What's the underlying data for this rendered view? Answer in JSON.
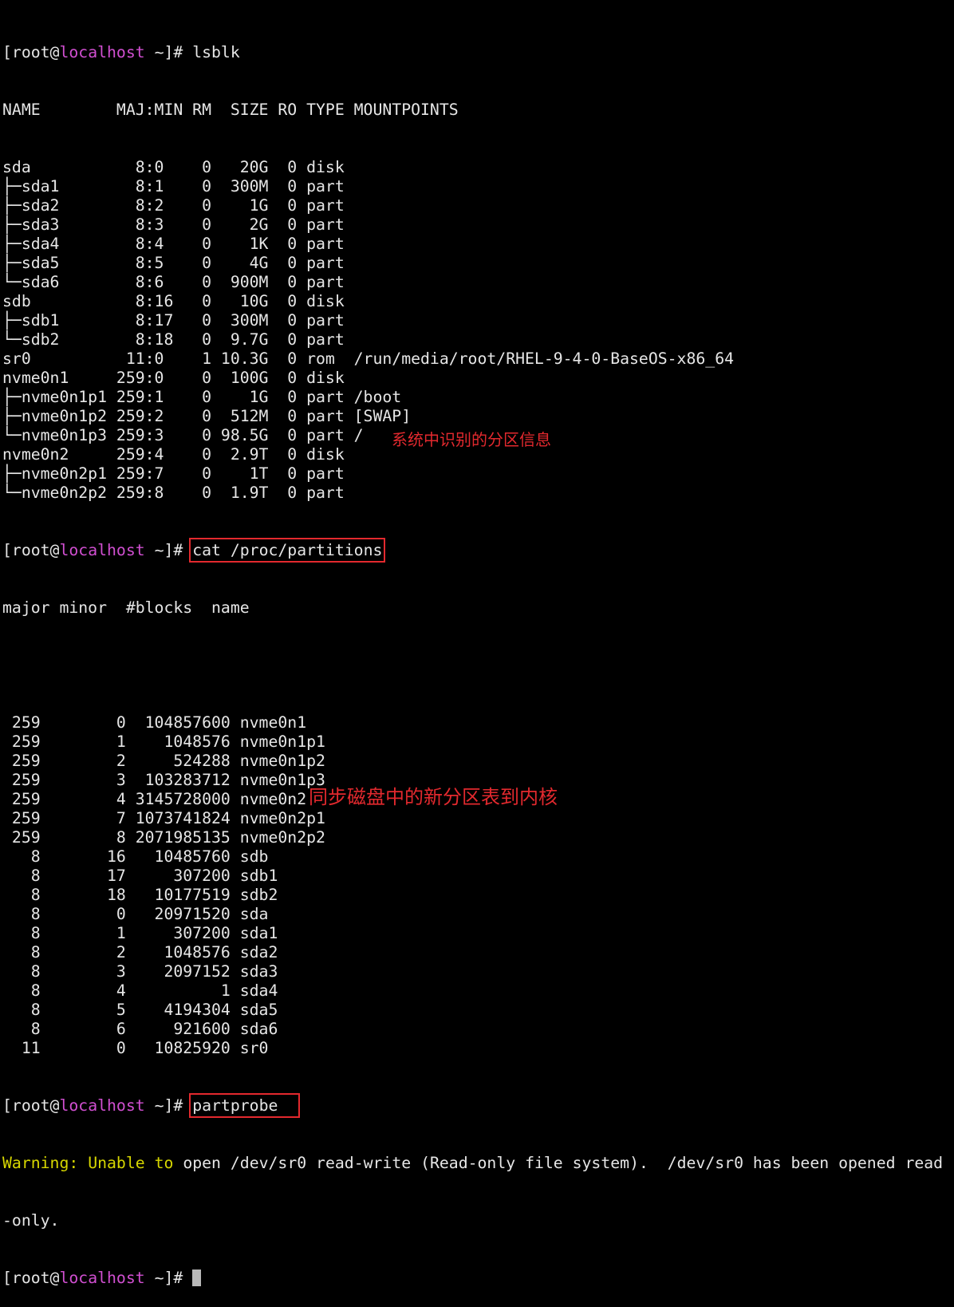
{
  "prompt": {
    "open": "[root@",
    "host": "localhost",
    "close": " ~]# "
  },
  "colors": {
    "background": "#000000",
    "text": "#e6e6e6",
    "hostname": "#d14fd1",
    "warning": "#d7d700",
    "annotation": "#e3292e"
  },
  "commands": {
    "lsblk": "lsblk",
    "cat": "cat /proc/partitions",
    "partprobe": "partprobe",
    "final": ""
  },
  "lsblk": {
    "header": "NAME        MAJ:MIN RM  SIZE RO TYPE MOUNTPOINTS",
    "rows": [
      "sda           8:0    0   20G  0 disk",
      "├─sda1        8:1    0  300M  0 part",
      "├─sda2        8:2    0    1G  0 part",
      "├─sda3        8:3    0    2G  0 part",
      "├─sda4        8:4    0    1K  0 part",
      "├─sda5        8:5    0    4G  0 part",
      "└─sda6        8:6    0  900M  0 part",
      "sdb           8:16   0   10G  0 disk",
      "├─sdb1        8:17   0  300M  0 part",
      "└─sdb2        8:18   0  9.7G  0 part",
      "sr0          11:0    1 10.3G  0 rom  /run/media/root/RHEL-9-4-0-BaseOS-x86_64",
      "nvme0n1     259:0    0  100G  0 disk",
      "├─nvme0n1p1 259:1    0    1G  0 part /boot",
      "├─nvme0n1p2 259:2    0  512M  0 part [SWAP]",
      "└─nvme0n1p3 259:3    0 98.5G  0 part /",
      "nvme0n2     259:4    0  2.9T  0 disk",
      "├─nvme0n2p1 259:7    0    1T  0 part",
      "└─nvme0n2p2 259:8    0  1.9T  0 part"
    ]
  },
  "partitions": {
    "header": "major minor  #blocks  name",
    "rows": [
      " 259        0  104857600 nvme0n1",
      " 259        1    1048576 nvme0n1p1",
      " 259        2     524288 nvme0n1p2",
      " 259        3  103283712 nvme0n1p3",
      " 259        4 3145728000 nvme0n2",
      " 259        7 1073741824 nvme0n2p1",
      " 259        8 2071985135 nvme0n2p2",
      "   8       16   10485760 sdb",
      "   8       17     307200 sdb1",
      "   8       18   10177519 sdb2",
      "   8        0   20971520 sda",
      "   8        1     307200 sda1",
      "   8        2    1048576 sda2",
      "   8        3    2097152 sda3",
      "   8        4          1 sda4",
      "   8        5    4194304 sda5",
      "   8        6     921600 sda6",
      "  11        0   10825920 sr0"
    ]
  },
  "warning": {
    "label": "Warning:",
    "sep1": " ",
    "unable": "Unable",
    "sep2": " ",
    "to": "to",
    "rest": " open /dev/sr0 read-write (Read-only file system).  /dev/sr0 has been opened read",
    "wrap": "-only."
  },
  "annotations": {
    "partitions_note": "系统中识别的分区信息",
    "partprobe_note": "同步磁盘中的新分区表到内核"
  }
}
